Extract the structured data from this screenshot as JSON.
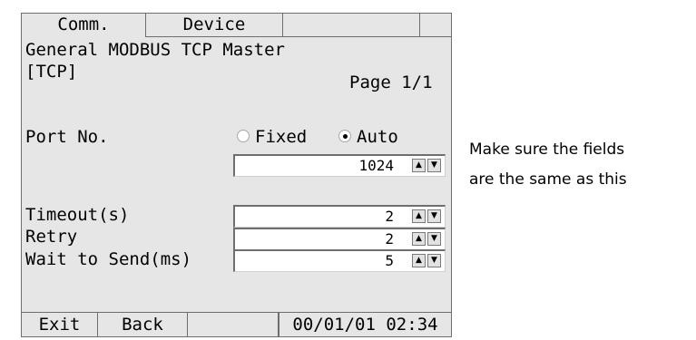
{
  "tabs": [
    {
      "label": "Comm."
    },
    {
      "label": "Device"
    },
    {
      "label": ""
    },
    {
      "label": ""
    }
  ],
  "header": {
    "driver": "General MODBUS TCP Master",
    "mode": "[TCP]",
    "page": "Page 1/1"
  },
  "port": {
    "label": "Port No.",
    "options": [
      "Fixed",
      "Auto"
    ],
    "selected": "Auto",
    "value": "1024"
  },
  "fields": [
    {
      "label": "Timeout(s)",
      "value": "2"
    },
    {
      "label": "Retry",
      "value": "2"
    },
    {
      "label": "Wait to Send(ms)",
      "value": "5"
    }
  ],
  "spin": {
    "up": "▲",
    "down": "▼"
  },
  "statusbar": {
    "exit": "Exit",
    "back": "Back",
    "datetime": "00/01/01 02:34"
  },
  "note": {
    "line1": "Make sure the fields",
    "line2": "are the same as this"
  }
}
